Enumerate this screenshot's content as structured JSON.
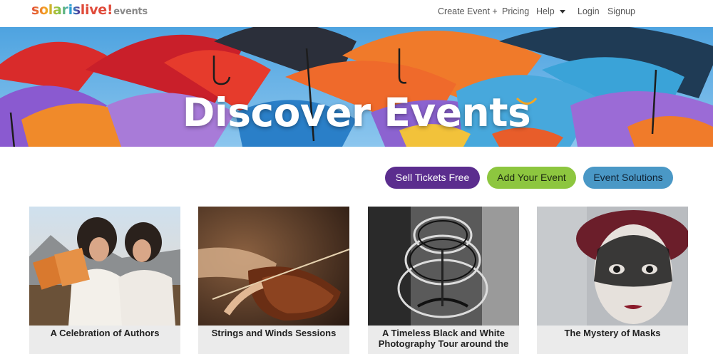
{
  "brand": {
    "logo_solaris": "solaris",
    "logo_live": "live!",
    "logo_events": "events",
    "colors": [
      "#e04b3a",
      "#f5a623",
      "#8dc63f",
      "#2a9fd6",
      "#5b2d8e"
    ]
  },
  "nav": {
    "create_event": "Create Event +",
    "pricing": "Pricing",
    "help": "Help",
    "login": "Login",
    "signup": "Signup"
  },
  "hero": {
    "title": "Discover Events"
  },
  "cta": {
    "sell_tickets": "Sell Tickets Free",
    "add_event": "Add Your Event",
    "event_solutions": "Event Solutions"
  },
  "events": [
    {
      "title": "A Celebration of Authors"
    },
    {
      "title": "Strings and Winds Sessions"
    },
    {
      "title": "A Timeless Black and White Photography Tour around the"
    },
    {
      "title": "The Mystery of Masks"
    }
  ],
  "theme": {
    "purple": "#5b2d8e",
    "green": "#8dc63f",
    "blue": "#4a98c6",
    "caption_bg": "#ebebeb"
  }
}
